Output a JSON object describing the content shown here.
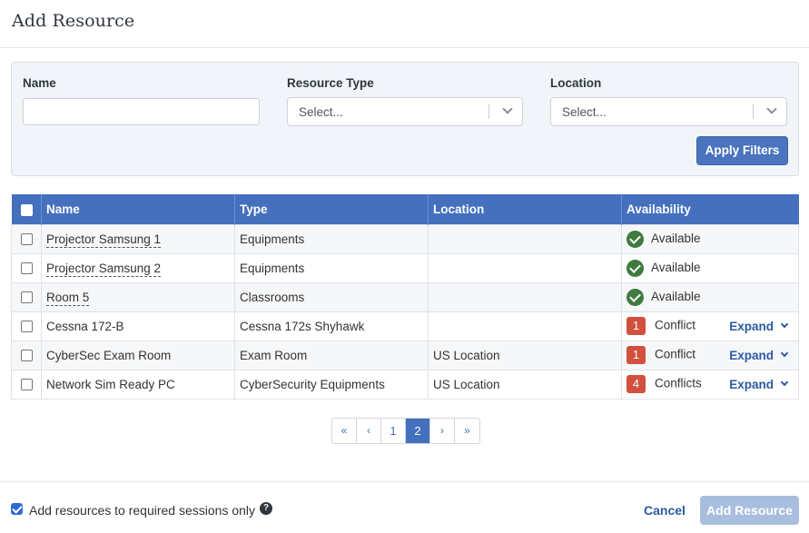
{
  "modal": {
    "title": "Add Resource"
  },
  "filters": {
    "name_label": "Name",
    "name_value": "",
    "type_label": "Resource Type",
    "type_placeholder": "Select...",
    "location_label": "Location",
    "location_placeholder": "Select...",
    "apply_label": "Apply Filters"
  },
  "table": {
    "columns": [
      "Name",
      "Type",
      "Location",
      "Availability"
    ],
    "rows": [
      {
        "name": "Projector Samsung 1",
        "type": "Equipments",
        "location": "",
        "status": "Available",
        "count": "",
        "expand": ""
      },
      {
        "name": "Projector Samsung 2",
        "type": "Equipments",
        "location": "",
        "status": "Available",
        "count": "",
        "expand": ""
      },
      {
        "name": "Room 5",
        "type": "Classrooms",
        "location": "",
        "status": "Available",
        "count": "",
        "expand": ""
      },
      {
        "name": "Cessna 172-B",
        "type": "Cessna 172s Shyhawk",
        "location": "",
        "status": "Conflict",
        "count": "1",
        "expand": "Expand"
      },
      {
        "name": "CyberSec Exam Room",
        "type": "Exam Room",
        "location": "US Location",
        "status": "Conflict",
        "count": "1",
        "expand": "Expand"
      },
      {
        "name": "Network Sim Ready PC",
        "type": "CyberSecurity Equipments",
        "location": "US Location",
        "status": "Conflicts",
        "count": "4",
        "expand": "Expand"
      }
    ]
  },
  "pagination": {
    "first": "«",
    "prev": "‹",
    "pages": [
      "1",
      "2"
    ],
    "current": "2",
    "next": "›",
    "last": "»"
  },
  "footer": {
    "checkbox_label": "Add resources to required sessions only",
    "help": "?",
    "cancel_label": "Cancel",
    "add_label": "Add Resource"
  },
  "colors": {
    "header": "#4470be",
    "conflict": "#d1503e",
    "available": "#3f7a3e"
  }
}
